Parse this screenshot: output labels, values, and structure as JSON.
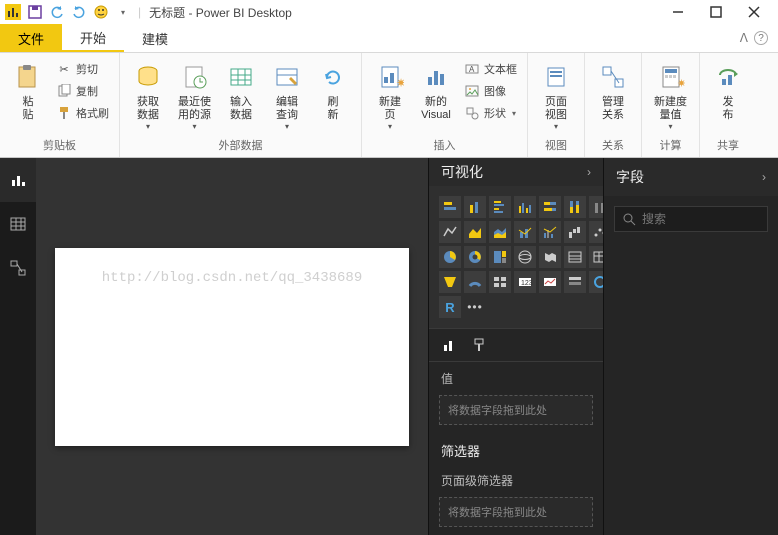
{
  "titlebar": {
    "title": "无标题 - Power BI Desktop",
    "qat": [
      "app",
      "save",
      "undo",
      "redo",
      "smiley"
    ]
  },
  "tabs": {
    "file": "文件",
    "items": [
      "开始",
      "建模"
    ],
    "active": 0
  },
  "ribbon": {
    "groups": {
      "clipboard": {
        "label": "剪贴板",
        "paste": "粘\n贴",
        "cut": "剪切",
        "copy": "复制",
        "format_painter": "格式刷"
      },
      "external": {
        "label": "外部数据",
        "get_data": "获取\n数据",
        "recent": "最近使\n用的源",
        "enter": "输入\n数据",
        "edit_query": "编辑\n查询",
        "refresh": "刷\n新"
      },
      "insert": {
        "label": "插入",
        "new_page": "新建\n页",
        "new_visual": "新的\nVisual",
        "textbox": "文本框",
        "image": "图像",
        "shape": "形状"
      },
      "view": {
        "label": "视图",
        "page_view": "页面\n视图"
      },
      "relationships": {
        "label": "关系",
        "manage": "管理\n关系"
      },
      "calc": {
        "label": "计算",
        "new_measure": "新建度\n量值"
      },
      "share": {
        "label": "共享",
        "publish": "发\n布"
      }
    }
  },
  "panes": {
    "viz": {
      "title": "可视化",
      "value_label": "值",
      "drop_hint": "将数据字段拖到此处",
      "filter_title": "筛选器",
      "page_filter_label": "页面级筛选器",
      "drop_hint2": "将数据字段拖到此处"
    },
    "fields": {
      "title": "字段",
      "search_placeholder": "搜索"
    }
  },
  "watermark": "http://blog.csdn.net/qq_3438689"
}
